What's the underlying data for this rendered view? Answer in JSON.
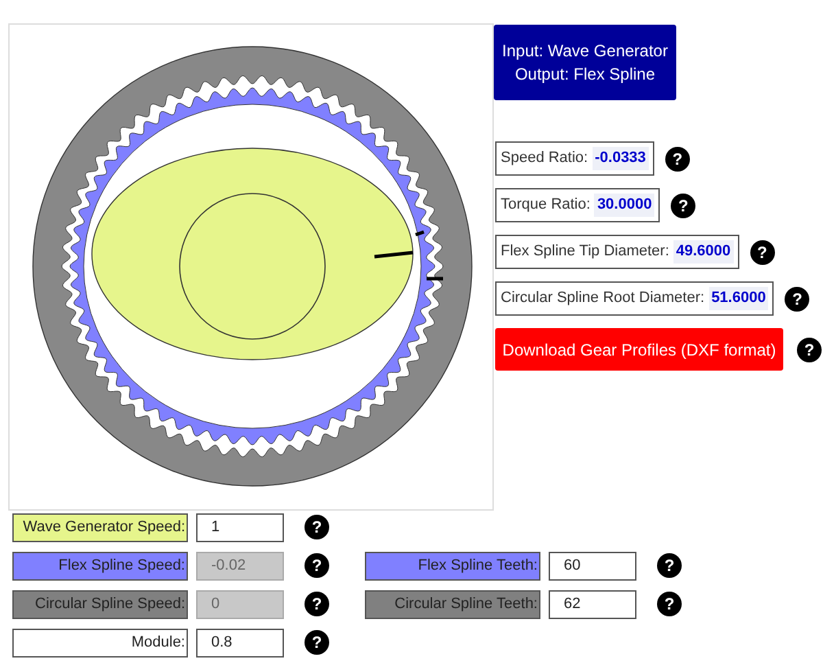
{
  "mode_button": {
    "lines": [
      "Input: Wave Generator",
      "Output: Flex Spline"
    ]
  },
  "results": [
    {
      "label": "Speed Ratio:",
      "value": "-0.0333",
      "help": "?"
    },
    {
      "label": "Torque Ratio:",
      "value": "30.0000",
      "help": "?"
    },
    {
      "label": "Flex Spline Tip Diameter:",
      "value": "49.6000",
      "help": "?"
    },
    {
      "label": "Circular Spline Root Diameter:",
      "value": "51.6000",
      "help": "?"
    }
  ],
  "download_button": {
    "label": "Download Gear Profiles (DXF format)",
    "help": "?"
  },
  "input_rows": [
    [
      {
        "label": "Wave Generator Speed:",
        "color": "#e6f58c",
        "value": "1",
        "disabled": false,
        "help": "?"
      }
    ],
    [
      {
        "label": "Flex Spline Speed:",
        "color": "#8080ff",
        "value": "-0.02",
        "disabled": true,
        "help": "?"
      },
      {
        "label": "Flex Spline Teeth:",
        "color": "#8080ff",
        "value": "60",
        "disabled": false,
        "help": "?"
      }
    ],
    [
      {
        "label": "Circular Spline Speed:",
        "color": "#808080",
        "value": "0",
        "disabled": true,
        "help": "?"
      },
      {
        "label": "Circular Spline Teeth:",
        "color": "#808080",
        "value": "62",
        "disabled": false,
        "help": "?"
      }
    ],
    [
      {
        "label": "Module:",
        "color": "#ffffff",
        "value": "0.8",
        "disabled": false,
        "help": "?"
      }
    ]
  ]
}
